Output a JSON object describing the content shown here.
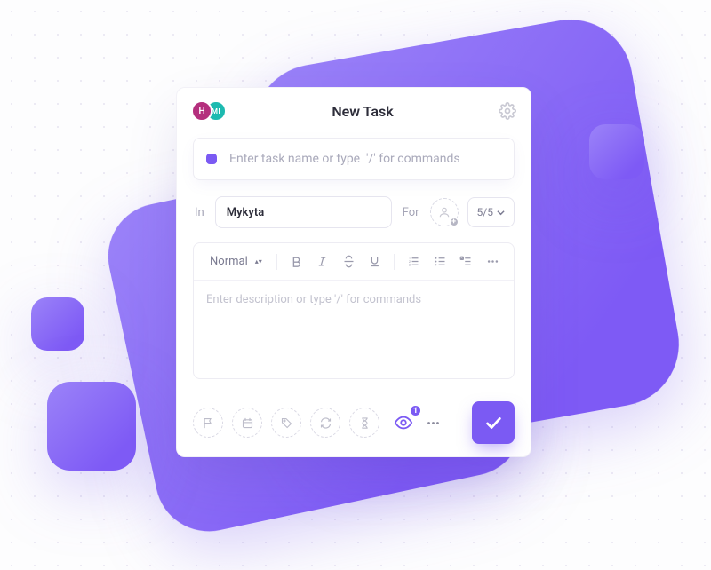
{
  "header": {
    "avatar1_letter": "H",
    "avatar2_letter": "MI",
    "title": "New Task"
  },
  "task": {
    "status_icon": "square-status",
    "name_value": "",
    "name_placeholder": "Enter task name or type  '/' for commands"
  },
  "meta": {
    "in_label": "In",
    "list_selected": "Mykyta",
    "for_label": "For",
    "priority_value": "5/5"
  },
  "editor": {
    "font_style": "Normal",
    "description_value": "",
    "description_placeholder": "Enter description or type '/' for commands"
  },
  "footer": {
    "watchers_count": "1",
    "action_icons": [
      "flag",
      "calendar",
      "tag",
      "recurrence",
      "hourglass"
    ]
  },
  "colors": {
    "accent": "#7b5af3"
  }
}
